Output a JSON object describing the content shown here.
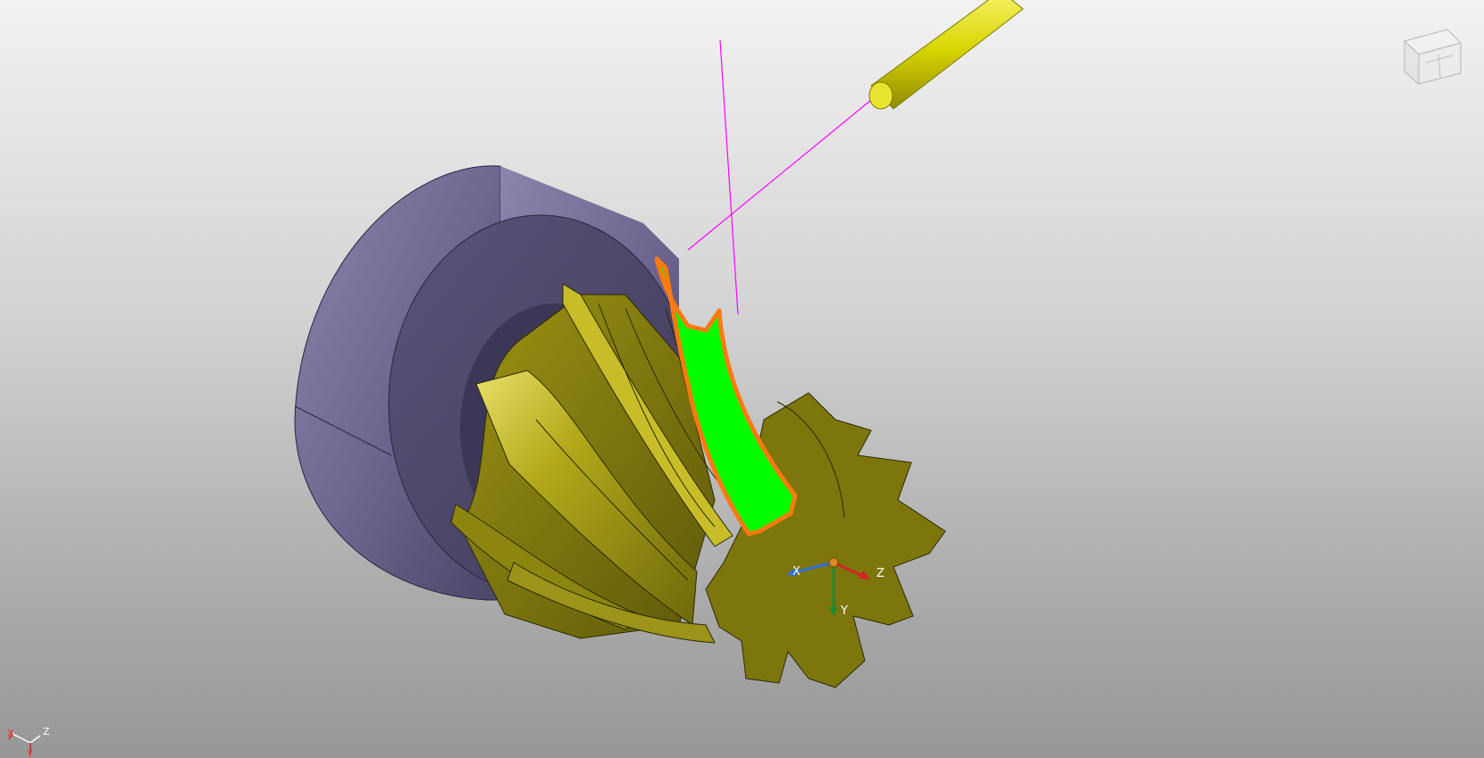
{
  "scene": {
    "background_top": "#f2f2f2",
    "background_bottom": "#979797",
    "part_color": "#a39a10",
    "part_dark": "#6b650a",
    "fixture_color": "#6a6288",
    "fixture_dark": "#4f4970",
    "highlight_face_color": "#00ff00",
    "highlight_edge_color": "#ff7a10",
    "tool_color": "#d8d400",
    "toolpath_color": "#ff00ff"
  },
  "part_triad": {
    "x_label": "X",
    "y_label": "Y",
    "z_label": "Z",
    "x_color": "#2f6fd6",
    "y_color": "#1f8a2f",
    "z_color": "#d42424"
  },
  "corner_triad": {
    "x_label": "X",
    "y_label": "Y",
    "z_label": "Z"
  },
  "view_cube": {
    "icon": "view-cube-icon"
  }
}
